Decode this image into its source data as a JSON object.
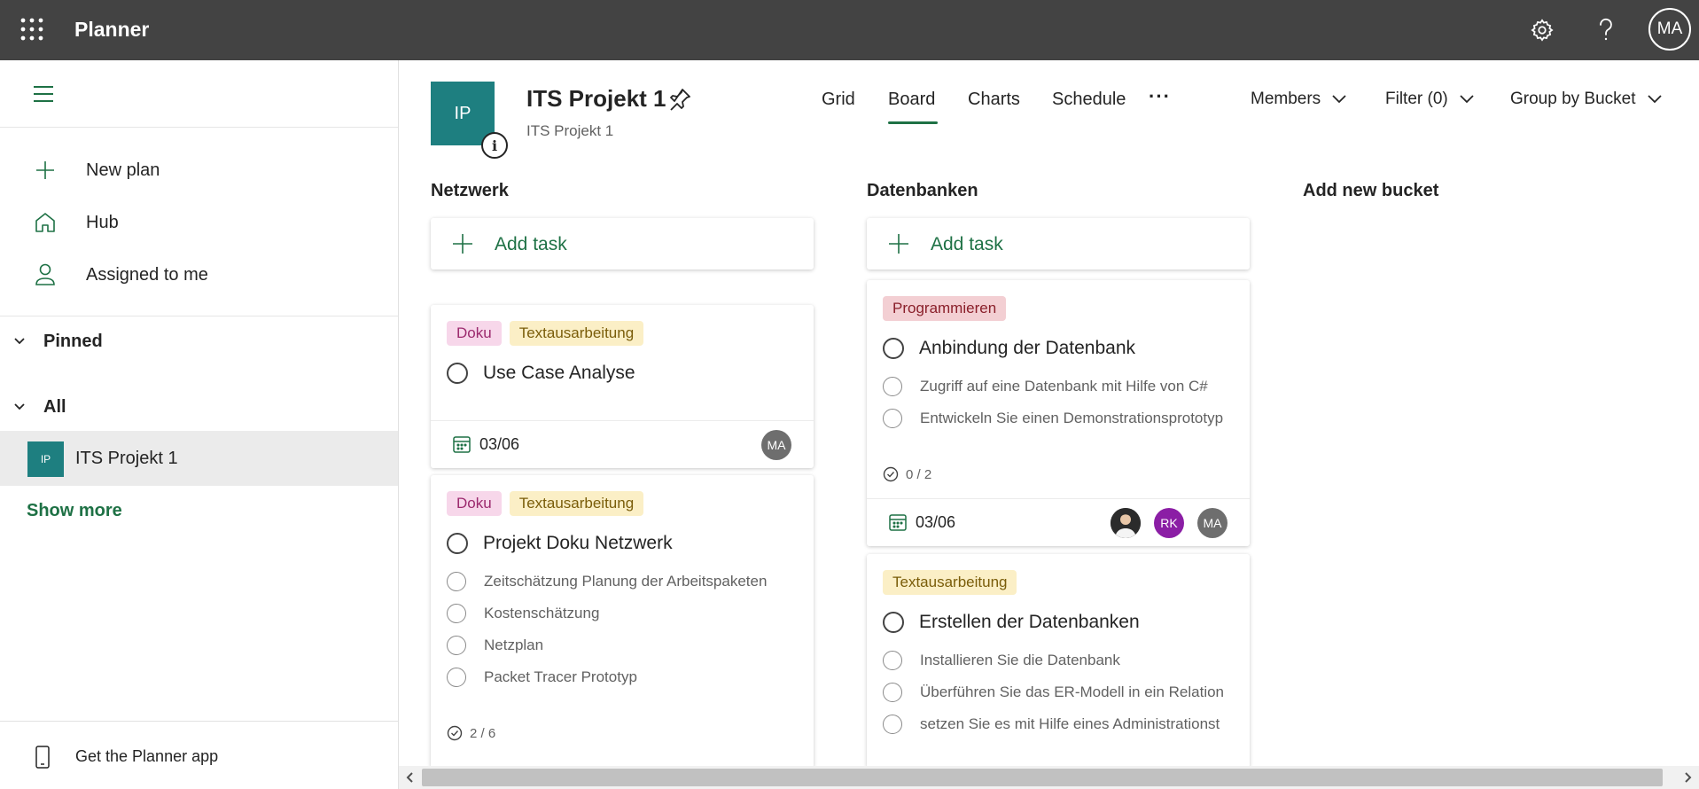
{
  "app": {
    "name": "Planner",
    "user_initials": "MA"
  },
  "topbar": {
    "waffle_icon": "app-launcher-icon",
    "settings_icon": "gear-icon",
    "help_icon": "question-icon"
  },
  "sidebar": {
    "nav_items": [
      {
        "label": "New plan",
        "icon": "plus-icon"
      },
      {
        "label": "Hub",
        "icon": "home-icon"
      },
      {
        "label": "Assigned to me",
        "icon": "person-icon"
      }
    ],
    "groups": {
      "pinned": "Pinned",
      "all": "All"
    },
    "plan": {
      "badge": "IP",
      "label": "ITS Projekt 1"
    },
    "show_more": "Show more",
    "get_app": "Get the Planner app"
  },
  "plan_header": {
    "logo_initials": "IP",
    "info_glyph": "i",
    "title": "ITS Projekt 1",
    "subtitle": "ITS Projekt 1",
    "tabs": [
      "Grid",
      "Board",
      "Charts",
      "Schedule"
    ],
    "active_tab": "Board",
    "more": "···",
    "members": "Members",
    "filter": "Filter (0)",
    "group_by": "Group by Bucket"
  },
  "buckets": [
    {
      "name": "Netzwerk",
      "add_task": "Add task",
      "cards": [
        {
          "labels": [
            {
              "text": "Doku",
              "color": "#f7d7ea"
            },
            {
              "text": "Textausarbeitung",
              "color": "#fbefc6"
            }
          ],
          "title": "Use Case Analyse",
          "due": "03/06",
          "assignees": [
            "MA"
          ]
        },
        {
          "labels": [
            {
              "text": "Doku",
              "color": "#f7d7ea"
            },
            {
              "text": "Textausarbeitung",
              "color": "#fbefc6"
            }
          ],
          "title": "Projekt Doku Netzwerk",
          "checklist": [
            "Zeitschätzung Planung der Arbeitspaketen",
            "Kostenschätzung",
            "Netzplan",
            "Packet Tracer Prototyp"
          ],
          "progress": "2 / 6"
        }
      ]
    },
    {
      "name": "Datenbanken",
      "add_task": "Add task",
      "cards": [
        {
          "labels": [
            {
              "text": "Programmieren",
              "color": "#f3cfd3"
            }
          ],
          "title": "Anbindung der Datenbank",
          "checklist": [
            "Zugriff auf eine Datenbank mit Hilfe von C#",
            "Entwickeln Sie einen Demonstrationsprototyp"
          ],
          "progress": "0 / 2",
          "due": "03/06",
          "assignees": [
            "photo",
            "RK",
            "MA"
          ]
        },
        {
          "labels": [
            {
              "text": "Textausarbeitung",
              "color": "#fbefc6"
            }
          ],
          "title": "Erstellen der Datenbanken",
          "checklist": [
            "Installieren Sie die Datenbank",
            "Überführen Sie das ER-Modell in ein Relation",
            "setzen Sie es mit Hilfe eines Administrationst"
          ]
        }
      ]
    }
  ],
  "add_bucket": "Add new bucket"
}
